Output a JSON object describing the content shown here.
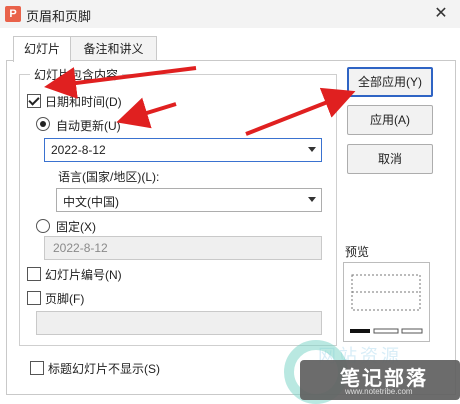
{
  "window": {
    "title": "页眉和页脚",
    "app_icon_letter": "P",
    "close_glyph": "✕"
  },
  "tabs": [
    {
      "label": "幻灯片",
      "active": true
    },
    {
      "label": "备注和讲义",
      "active": false
    }
  ],
  "include_group": {
    "legend": "幻灯片包含内容",
    "date_time": {
      "label": "日期和时间(D)",
      "checked": true
    },
    "auto_update": {
      "label": "自动更新(U)",
      "selected": true,
      "value": "2022-8-12"
    },
    "language": {
      "label": "语言(国家/地区)(L):",
      "value": "中文(中国)"
    },
    "fixed": {
      "label": "固定(X)",
      "selected": false,
      "value": "2022-8-12"
    },
    "slide_number": {
      "label": "幻灯片编号(N)",
      "checked": false
    },
    "footer": {
      "label": "页脚(F)",
      "checked": false,
      "value": ""
    }
  },
  "hide_on_title": {
    "label": "标题幻灯片不显示(S)",
    "checked": false
  },
  "buttons": {
    "apply_all": "全部应用(Y)",
    "apply": "应用(A)",
    "cancel": "取消"
  },
  "preview": {
    "label": "预览"
  },
  "watermark": {
    "brand": "笔记部落",
    "url": "www.notetribe.com",
    "top_text": "网站资源"
  },
  "colors": {
    "accent": "#2f64c4",
    "annotation_arrow": "#e02020",
    "app_icon": "#e9624a"
  }
}
